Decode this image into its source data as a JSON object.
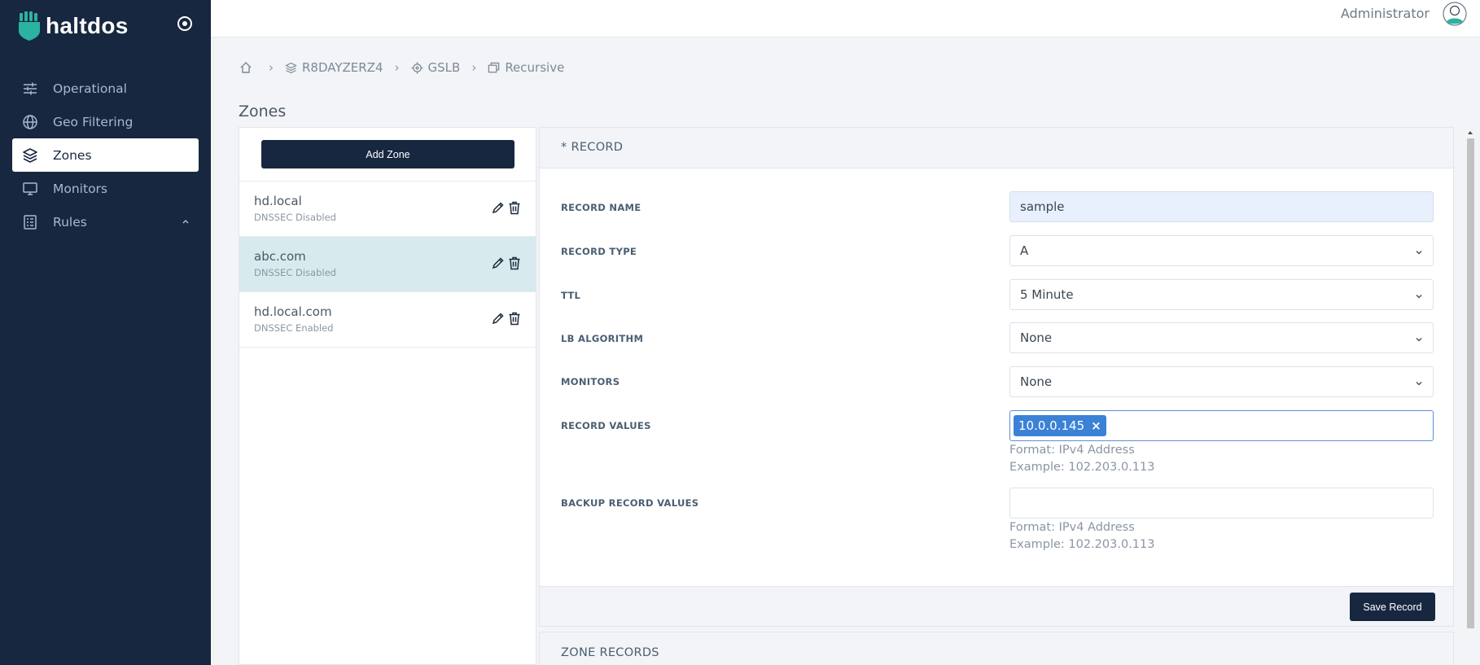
{
  "brand": {
    "name": "haltdos"
  },
  "sidebar": {
    "items": [
      {
        "label": "Operational",
        "icon": "sliders-icon",
        "active": false
      },
      {
        "label": "Geo Filtering",
        "icon": "globe-icon",
        "active": false
      },
      {
        "label": "Zones",
        "icon": "layers-icon",
        "active": true
      },
      {
        "label": "Monitors",
        "icon": "monitor-icon",
        "active": false
      },
      {
        "label": "Rules",
        "icon": "list-icon",
        "active": false,
        "expandable": true
      }
    ]
  },
  "topbar": {
    "user": "Administrator"
  },
  "breadcrumb": {
    "items": [
      {
        "label": "",
        "icon": "home-icon"
      },
      {
        "label": "R8DAYZERZ4",
        "icon": "layers-icon"
      },
      {
        "label": "GSLB",
        "icon": "crosshair-icon"
      },
      {
        "label": "Recursive",
        "icon": "windows-icon"
      }
    ],
    "separator": "›"
  },
  "page": {
    "title": "Zones"
  },
  "zones": {
    "add_label": "Add Zone",
    "items": [
      {
        "name": "hd.local",
        "dnssec": "DNSSEC Disabled",
        "selected": false
      },
      {
        "name": "abc.com",
        "dnssec": "DNSSEC Disabled",
        "selected": true
      },
      {
        "name": "hd.local.com",
        "dnssec": "DNSSEC Enabled",
        "selected": false
      }
    ]
  },
  "record": {
    "header": "* RECORD",
    "fields": {
      "record_name": {
        "label": "RECORD NAME",
        "value": "sample"
      },
      "record_type": {
        "label": "RECORD TYPE",
        "value": "A"
      },
      "ttl": {
        "label": "TTL",
        "value": "5 Minute"
      },
      "lb_algorithm": {
        "label": "LB ALGORITHM",
        "value": "None"
      },
      "monitors": {
        "label": "MONITORS",
        "value": "None"
      },
      "record_values": {
        "label": "RECORD VALUES",
        "tags": [
          "10.0.0.145"
        ],
        "tag_remove": "×",
        "help_format": "Format: IPv4 Address",
        "help_example": "Example: 102.203.0.113"
      },
      "backup_record_values": {
        "label": "BACKUP RECORD VALUES",
        "value": "",
        "help_format": "Format: IPv4 Address",
        "help_example": "Example: 102.203.0.113"
      }
    },
    "save_label": "Save Record"
  },
  "zone_records": {
    "header": "ZONE RECORDS"
  },
  "colors": {
    "sidebar_bg": "#172740",
    "logo_accent": "#2bb3a0",
    "selected_row": "#d7ebee",
    "tag_blue": "#3b82d6"
  }
}
